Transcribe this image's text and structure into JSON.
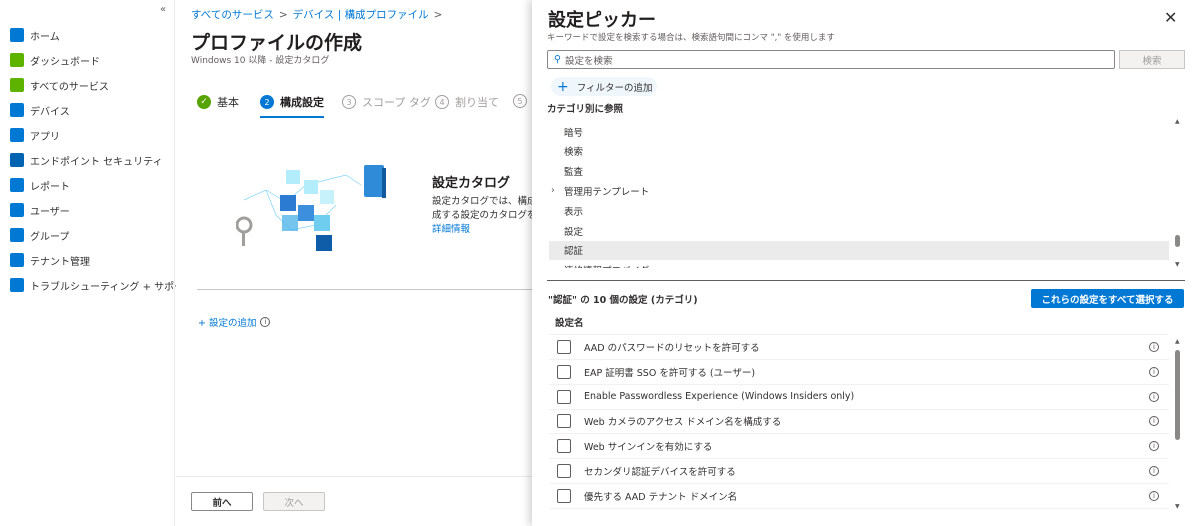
{
  "sidebar": {
    "collapse": "«",
    "items": [
      {
        "label": "ホーム",
        "icon": "home-icon",
        "color": "#0078d4"
      },
      {
        "label": "ダッシュボード",
        "icon": "dashboard-icon",
        "color": "#5db300"
      },
      {
        "label": "すべてのサービス",
        "icon": "list-icon",
        "color": "#5db300"
      },
      {
        "label": "デバイス",
        "icon": "device-icon",
        "color": "#0078d4"
      },
      {
        "label": "アプリ",
        "icon": "apps-icon",
        "color": "#0078d4"
      },
      {
        "label": "エンドポイント セキュリティ",
        "icon": "shield-icon",
        "color": "#0063b1"
      },
      {
        "label": "レポート",
        "icon": "report-icon",
        "color": "#0078d4"
      },
      {
        "label": "ユーザー",
        "icon": "user-icon",
        "color": "#0078d4"
      },
      {
        "label": "グループ",
        "icon": "group-icon",
        "color": "#0078d4"
      },
      {
        "label": "テナント管理",
        "icon": "tenant-icon",
        "color": "#0078d4"
      },
      {
        "label": "トラブルシューティング + サポート",
        "icon": "tools-icon",
        "color": "#0078d4"
      }
    ]
  },
  "main": {
    "breadcrumb": [
      "すべてのサービス",
      "デバイス | 構成プロファイル"
    ],
    "breadcrumb_sep": ">",
    "title": "プロファイルの作成",
    "more": "...",
    "subtitle": "Windows 10 以降 - 設定カタログ",
    "steps": [
      {
        "num": "✓",
        "label": "基本",
        "state": "done"
      },
      {
        "num": "2",
        "label": "構成設定",
        "state": "active"
      },
      {
        "num": "3",
        "label": "スコープ タグ",
        "state": "pending"
      },
      {
        "num": "4",
        "label": "割り当て",
        "state": "pending"
      },
      {
        "num": "5",
        "label": "",
        "state": "pending"
      }
    ],
    "catalog": {
      "title": "設定カタログ",
      "line1": "設定カタログでは、構成す",
      "line2": "成する設定のカタログを参",
      "link": "詳細情報"
    },
    "add_settings": "+ 設定の追加",
    "prev": "前へ",
    "next": "次へ"
  },
  "panel": {
    "title": "設定ピッカー",
    "close": "✕",
    "subtitle": "キーワードで設定を検索する場合は、検索語句間にコンマ \",\" を使用します",
    "search_placeholder": "設定を検索",
    "search_button": "検索",
    "add_filter": "フィルターの追加",
    "browse_label": "カテゴリ別に参照",
    "categories": [
      {
        "label": "暗号"
      },
      {
        "label": "検索"
      },
      {
        "label": "監査"
      },
      {
        "label": "管理用テンプレート",
        "expandable": true
      },
      {
        "label": "表示"
      },
      {
        "label": "設定"
      },
      {
        "label": "認証",
        "selected": true
      },
      {
        "label": "連絡情報プロバイダー"
      }
    ],
    "section_heading": "\"認証\" の 10 個の設定 (カテゴリ)",
    "select_all": "これらの設定をすべて選択する",
    "column_header": "設定名",
    "settings": [
      "AAD のパスワードのリセットを許可する",
      "EAP 証明書 SSO を許可する (ユーザー)",
      "Enable Passwordless Experience (Windows Insiders only)",
      "Web カメラのアクセス ドメイン名を構成する",
      "Web サインインを有効にする",
      "セカンダリ認証デバイスを許可する",
      "優先する AAD テナント ドメイン名"
    ],
    "accent": "#0078d4"
  }
}
